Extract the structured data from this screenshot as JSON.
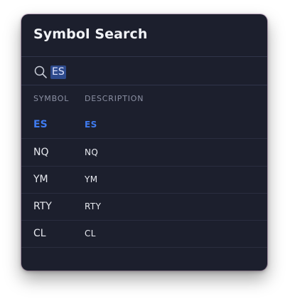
{
  "dialog": {
    "title": "Symbol Search"
  },
  "search": {
    "value": "ES",
    "icon": "search-icon"
  },
  "table": {
    "columns": {
      "symbol": "SYMBOL",
      "description": "DESCRIPTION"
    },
    "rows": [
      {
        "symbol": "ES",
        "description": "ES",
        "selected": true
      },
      {
        "symbol": "NQ",
        "description": "NQ"
      },
      {
        "symbol": "YM",
        "description": "YM"
      },
      {
        "symbol": "RTY",
        "description": "RTY"
      },
      {
        "symbol": "CL",
        "description": "CL"
      }
    ]
  },
  "colors": {
    "background": "#1c1f2d",
    "accent": "#3f7bf0",
    "text": "#e7e9ef",
    "muted": "#8b90a3"
  }
}
